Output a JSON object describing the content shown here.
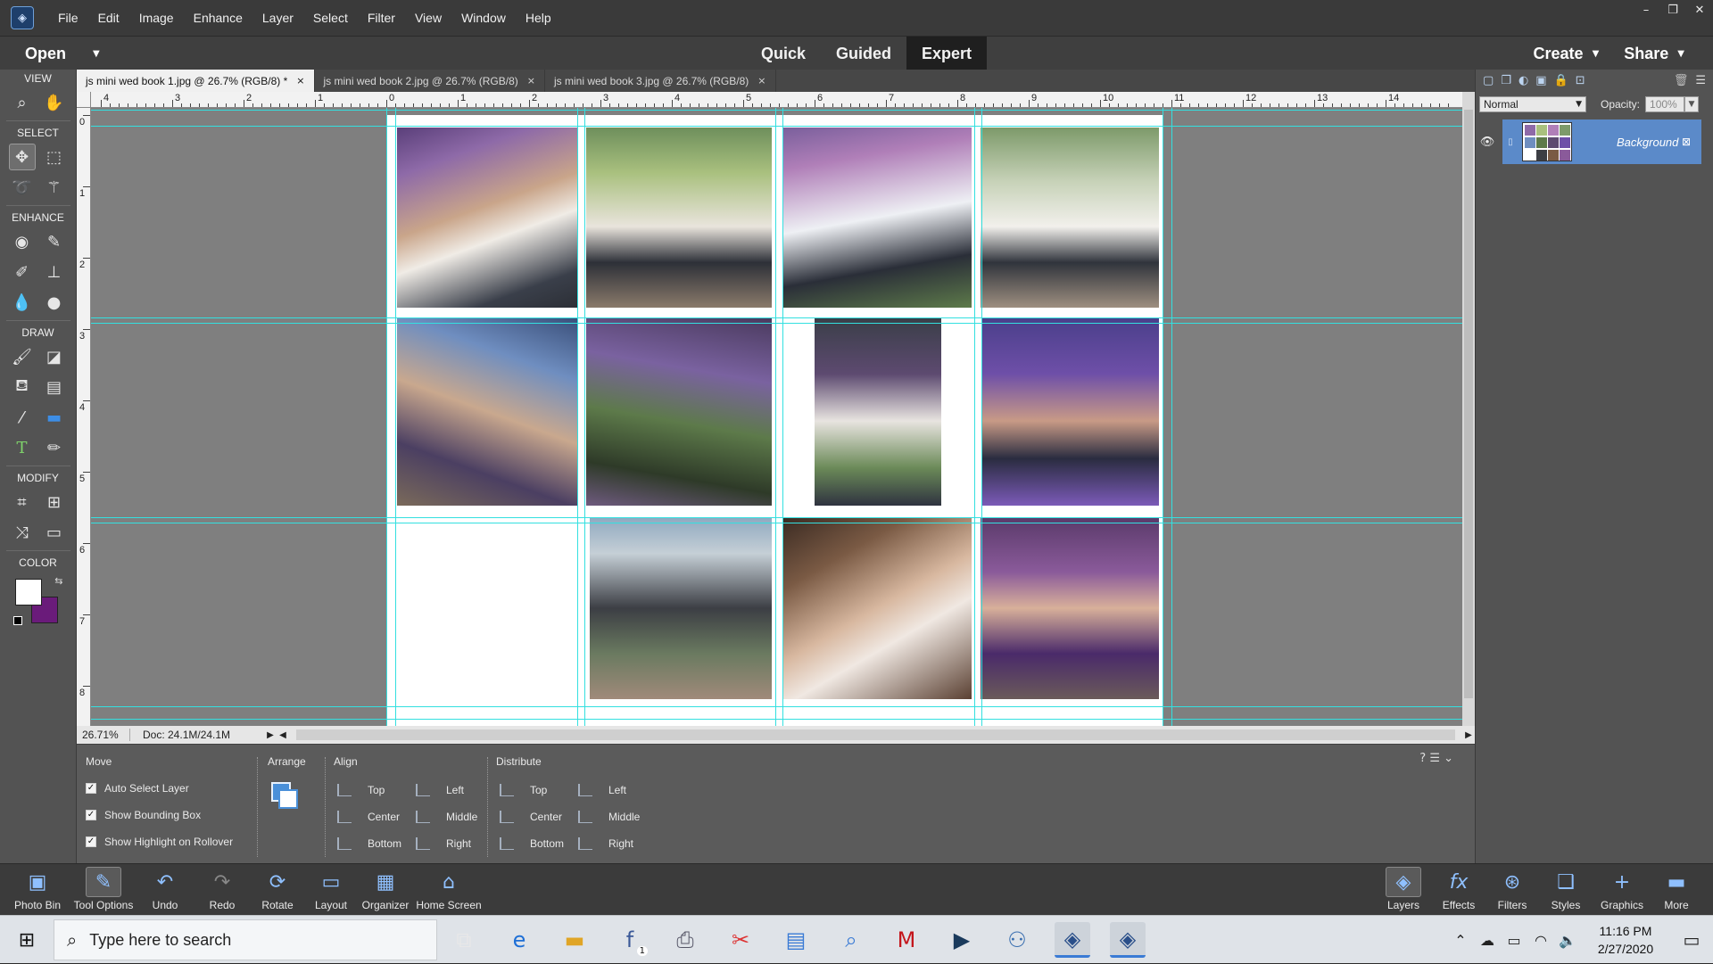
{
  "app": {
    "menu": [
      "File",
      "Edit",
      "Image",
      "Enhance",
      "Layer",
      "Select",
      "Filter",
      "View",
      "Window",
      "Help"
    ],
    "window_controls": {
      "minimize": "–",
      "restore": "❐",
      "close": "✕"
    }
  },
  "modebar": {
    "open_label": "Open",
    "modes": [
      "Quick",
      "Guided",
      "Expert"
    ],
    "active_mode": "Expert",
    "create_label": "Create",
    "share_label": "Share"
  },
  "toolbox": {
    "sections": {
      "view": "VIEW",
      "select": "SELECT",
      "enhance": "ENHANCE",
      "draw": "DRAW",
      "modify": "MODIFY",
      "color": "COLOR"
    },
    "foreground_color": "#ffffff",
    "background_color": "#6a1b7a"
  },
  "tabs": [
    {
      "label": "js mini wed book 1.jpg @ 26.7% (RGB/8) *",
      "active": true
    },
    {
      "label": "js mini wed book 2.jpg @ 26.7% (RGB/8)",
      "active": false
    },
    {
      "label": "js mini wed book 3.jpg @ 26.7% (RGB/8)",
      "active": false
    }
  ],
  "rulers": {
    "horizontal": [
      "4",
      "3",
      "2",
      "1",
      "0",
      "1",
      "2",
      "3",
      "4",
      "5",
      "6",
      "7",
      "8",
      "9",
      "10",
      "11",
      "12",
      "13",
      "14"
    ],
    "vertical": [
      "0",
      "1",
      "2",
      "3",
      "4",
      "5",
      "6",
      "7",
      "8"
    ]
  },
  "status": {
    "zoom": "26.71%",
    "doc": "Doc: 24.1M/24.1M"
  },
  "tool_options": {
    "move_title": "Move",
    "checks": [
      {
        "label": "Auto Select Layer",
        "checked": true
      },
      {
        "label": "Show Bounding Box",
        "checked": true
      },
      {
        "label": "Show Highlight on Rollover",
        "checked": true
      }
    ],
    "arrange_title": "Arrange",
    "align_title": "Align",
    "align": [
      "Top",
      "Center",
      "Bottom",
      "Left",
      "Middle",
      "Right"
    ],
    "distribute_title": "Distribute",
    "distribute": [
      "Top",
      "Center",
      "Bottom",
      "Left",
      "Middle",
      "Right"
    ]
  },
  "layers_panel": {
    "blend_mode": "Normal",
    "opacity_label": "Opacity:",
    "opacity_value": "100%",
    "layer_name": "Background"
  },
  "bottom_bar": {
    "left": [
      "Photo Bin",
      "Tool Options",
      "Undo",
      "Redo",
      "Rotate",
      "Layout",
      "Organizer",
      "Home Screen"
    ],
    "right": [
      "Layers",
      "Effects",
      "Filters",
      "Styles",
      "Graphics",
      "More"
    ]
  },
  "taskbar": {
    "search_placeholder": "Type here to search",
    "time": "11:16 PM",
    "date": "2/27/2020",
    "facebook_badge": "1"
  },
  "colors": {
    "guide": "#33e0e0",
    "accent": "#5b8ac9"
  }
}
